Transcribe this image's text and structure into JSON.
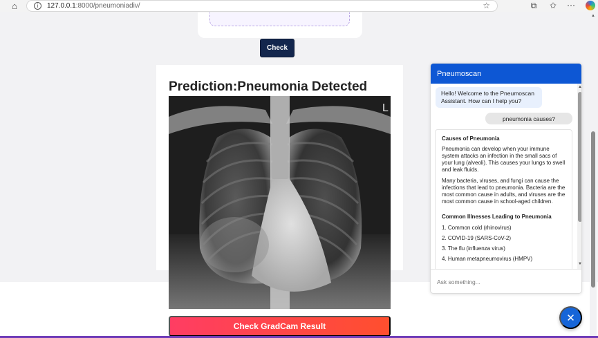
{
  "browser": {
    "url_host": "127.0.0.1",
    "url_path": ":8000/pneumoniadiv/",
    "icons": [
      "home-icon",
      "info-icon",
      "star-icon",
      "extensions-icon",
      "favorites-icon",
      "more-icon",
      "copilot-icon"
    ]
  },
  "page": {
    "check_label": "Check",
    "prediction_title": "Prediction:Pneumonia Detected",
    "xray_marker": "L",
    "gradcam_label": "Check GradCam Result"
  },
  "chat": {
    "title": "Pneumoscan",
    "welcome": "Hello! Welcome to the Pneumoscan Assistant. How can I help you?",
    "user_message": "pneumonia causes?",
    "answer": {
      "heading": "Causes of Pneumonia",
      "paragraph1": "Pneumonia can develop when your immune system attacks an infection in the small sacs of your lung (alveoli). This causes your lungs to swell and leak fluids.",
      "paragraph2": "Many bacteria, viruses, and fungi can cause the infections that lead to pneumonia. Bacteria are the most common cause in adults, and viruses are the most common cause in school-aged children.",
      "heading2": "Common Illnesses Leading to Pneumonia",
      "items": [
        "1. Common cold (rhinovirus)",
        "2. COVID-19 (SARS-CoV-2)",
        "3. The flu (influenza virus)",
        "4. Human metapneumovirus (HMPV)"
      ]
    },
    "input_placeholder": "Ask something...",
    "close_symbol": "✕"
  },
  "colors": {
    "chat_header": "#0d57d4",
    "check_button": "#13264d",
    "gradcam_start": "#ff3d63",
    "gradcam_end": "#ff4f2e",
    "fab": "#1665d8"
  }
}
